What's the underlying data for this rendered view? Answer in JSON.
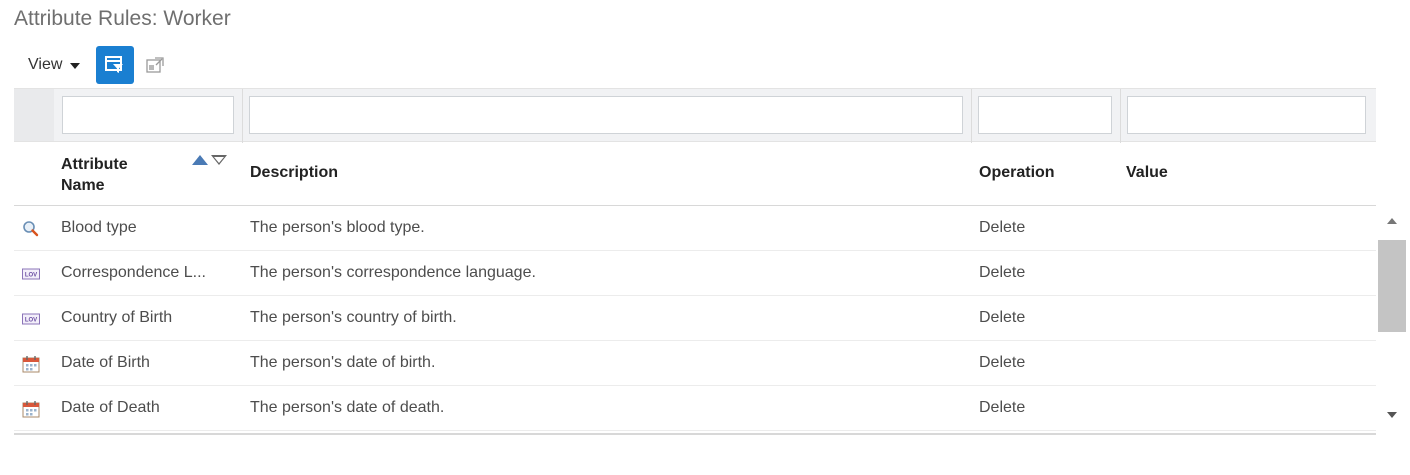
{
  "page": {
    "title": "Attribute Rules: Worker"
  },
  "toolbar": {
    "view_label": "View",
    "buttons": [
      {
        "icon": "query-by-example-icon",
        "active": true
      },
      {
        "icon": "detach-icon",
        "active": false
      }
    ]
  },
  "filters": {
    "name": "",
    "description": "",
    "operation": "",
    "value": ""
  },
  "columns": {
    "name": "Attribute Name",
    "description": "Description",
    "operation": "Operation",
    "value": "Value"
  },
  "rows": [
    {
      "icon": "search-icon",
      "name": "Blood type",
      "description": "The person's blood type.",
      "operation": "Delete",
      "value": ""
    },
    {
      "icon": "list-of-values-icon",
      "name": "Correspondence L...",
      "description": "The person's correspondence language.",
      "operation": "Delete",
      "value": ""
    },
    {
      "icon": "list-of-values-icon",
      "name": "Country of Birth",
      "description": "The person's country of birth.",
      "operation": "Delete",
      "value": ""
    },
    {
      "icon": "calendar-icon",
      "name": "Date of Birth",
      "description": "The person's date of birth.",
      "operation": "Delete",
      "value": ""
    },
    {
      "icon": "calendar-icon",
      "name": "Date of Death",
      "description": "The person's date of death.",
      "operation": "Delete",
      "value": ""
    }
  ],
  "colors": {
    "accent": "#1a7fd1",
    "sort_active": "#4a7ab5"
  }
}
